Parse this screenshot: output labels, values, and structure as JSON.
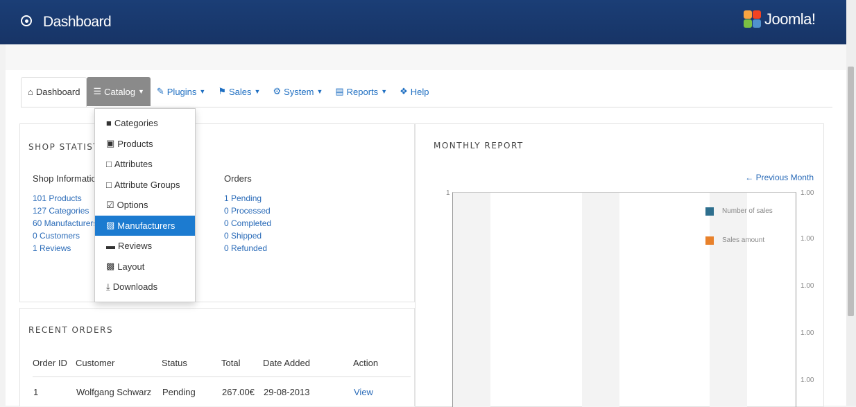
{
  "app": {
    "title": "Dashboard",
    "logo_text": "Joomla!"
  },
  "nav": [
    {
      "label": "Dashboard",
      "icon": "home-icon"
    },
    {
      "label": "Catalog",
      "icon": "list-icon"
    },
    {
      "label": "Plugins",
      "icon": "wrench-icon"
    },
    {
      "label": "Sales",
      "icon": "bank-icon"
    },
    {
      "label": "System",
      "icon": "gear-icon"
    },
    {
      "label": "Reports",
      "icon": "report-icon"
    },
    {
      "label": "Help",
      "icon": "help-icon"
    }
  ],
  "catalog_menu": [
    {
      "label": "Categories",
      "icon": "folder-icon"
    },
    {
      "label": "Products",
      "icon": "box-icon"
    },
    {
      "label": "Attributes",
      "icon": "attribute-icon"
    },
    {
      "label": "Attribute Groups",
      "icon": "attribute-group-icon"
    },
    {
      "label": "Options",
      "icon": "checkbox-icon"
    },
    {
      "label": "Manufacturers",
      "icon": "truck-icon"
    },
    {
      "label": "Reviews",
      "icon": "comment-icon"
    },
    {
      "label": "Layout",
      "icon": "briefcase-icon"
    },
    {
      "label": "Downloads",
      "icon": "download-icon"
    }
  ],
  "shop_stats": {
    "title": "SHOP STATISTICS",
    "info_header": "Shop Information",
    "orders_header": "Orders",
    "info_items": [
      "101 Products",
      "127 Categories",
      "60 Manufacturers",
      "0 Customers",
      "1 Reviews"
    ],
    "order_items": [
      "1 Pending",
      "0 Processed",
      "0 Completed",
      "0 Shipped",
      "0 Refunded"
    ]
  },
  "recent_orders": {
    "title": "RECENT ORDERS",
    "columns": [
      "Order ID",
      "Customer",
      "Status",
      "Total",
      "Date Added",
      "Action"
    ],
    "rows": [
      [
        "1",
        "Wolfgang Schwarz",
        "Pending",
        "267.00€",
        "29-08-2013",
        "View"
      ]
    ]
  },
  "monthly_report": {
    "title": "MONTHLY REPORT",
    "prev_link": "← Previous Month",
    "legend": [
      {
        "label": "Number of sales",
        "color": "#2e6f8e"
      },
      {
        "label": "Sales amount",
        "color": "#e8812b"
      }
    ],
    "left_tick": "1",
    "right_ticks": [
      "1.00",
      "1.00",
      "1.00",
      "1.00",
      "1.00"
    ]
  },
  "colors": {
    "topbar": "#173466",
    "accent": "#1c7bd0",
    "link": "#2a6bb8"
  }
}
